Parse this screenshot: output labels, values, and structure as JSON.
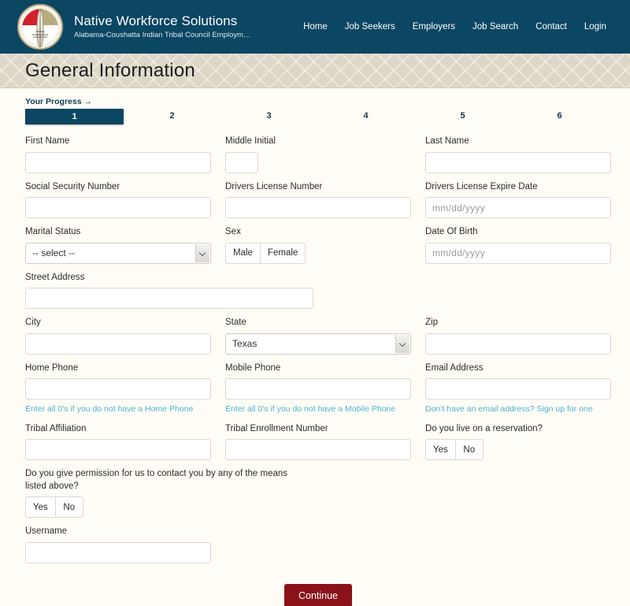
{
  "header": {
    "brand_title": "Native Workforce Solutions",
    "brand_subtitle": "Alabama-Coushatta Indian Tribal Council Employm…",
    "logo_text_line1": "NATIVE",
    "logo_text_line2": "WORKFORCE",
    "logo_text_line3": "SOLUTIONS",
    "nav": [
      {
        "label": "Home"
      },
      {
        "label": "Job Seekers"
      },
      {
        "label": "Employers"
      },
      {
        "label": "Job Search"
      },
      {
        "label": "Contact"
      },
      {
        "label": "Login"
      }
    ],
    "colors": {
      "header_bg": "#0b4663",
      "banner_bg": "#ddd7c7",
      "accent_red": "#8b1219",
      "link_blue": "#4ab3d1"
    }
  },
  "page": {
    "title": "General Information",
    "progress_label": "Your Progress →",
    "steps": [
      {
        "label": "1",
        "active": true
      },
      {
        "label": "2",
        "active": false
      },
      {
        "label": "3",
        "active": false
      },
      {
        "label": "4",
        "active": false
      },
      {
        "label": "5",
        "active": false
      },
      {
        "label": "6",
        "active": false
      }
    ]
  },
  "form": {
    "first_name": {
      "label": "First Name",
      "value": "",
      "placeholder": ""
    },
    "middle_initial": {
      "label": "Middle Initial",
      "value": "",
      "placeholder": ""
    },
    "last_name": {
      "label": "Last Name",
      "value": "",
      "placeholder": ""
    },
    "ssn": {
      "label": "Social Security Number",
      "value": "",
      "placeholder": ""
    },
    "dl_number": {
      "label": "Drivers License Number",
      "value": "",
      "placeholder": ""
    },
    "dl_expire": {
      "label": "Drivers License Expire Date",
      "value": "",
      "placeholder": "mm/dd/yyyy"
    },
    "marital_status": {
      "label": "Marital Status",
      "selected": "-- select --"
    },
    "sex": {
      "label": "Sex",
      "options": [
        "Male",
        "Female"
      ],
      "selected": ""
    },
    "dob": {
      "label": "Date Of Birth",
      "value": "",
      "placeholder": "mm/dd/yyyy"
    },
    "street_address": {
      "label": "Street Address",
      "value": "",
      "placeholder": ""
    },
    "city": {
      "label": "City",
      "value": "",
      "placeholder": ""
    },
    "state": {
      "label": "State",
      "selected": "Texas"
    },
    "zip": {
      "label": "Zip",
      "value": "",
      "placeholder": ""
    },
    "home_phone": {
      "label": "Home Phone",
      "value": "",
      "placeholder": "",
      "help": "Enter all 0's if you do not have a Home Phone"
    },
    "mobile_phone": {
      "label": "Mobile Phone",
      "value": "",
      "placeholder": "",
      "help": "Enter all 0's if you do not have a Mobile Phone"
    },
    "email": {
      "label": "Email Address",
      "value": "",
      "placeholder": "",
      "help": "Don't have an email address? Sign up for one"
    },
    "tribal_affiliation": {
      "label": "Tribal Affiliation",
      "value": "",
      "placeholder": ""
    },
    "tribal_enrollment_number": {
      "label": "Tribal Enrollment Number",
      "value": "",
      "placeholder": ""
    },
    "reservation": {
      "label": "Do you live on a reservation?",
      "options": [
        "Yes",
        "No"
      ],
      "selected": ""
    },
    "contact_permission": {
      "label": "Do you give permission for us to contact you by any of the means listed above?",
      "options": [
        "Yes",
        "No"
      ],
      "selected": ""
    },
    "username": {
      "label": "Username",
      "value": "",
      "placeholder": ""
    },
    "submit": {
      "label": "Continue"
    }
  }
}
